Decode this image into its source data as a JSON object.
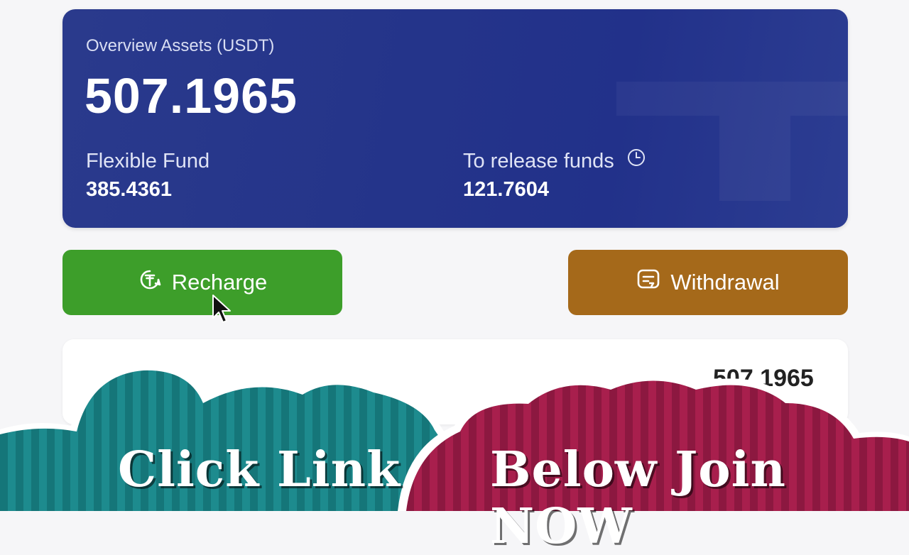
{
  "overview": {
    "title": "Overview Assets (USDT)",
    "total": "507.1965",
    "flexible_label": "Flexible Fund",
    "flexible_value": "385.4361",
    "release_label": "To release funds",
    "release_value": "121.7604"
  },
  "actions": {
    "recharge_label": "Recharge",
    "withdrawal_label": "Withdrawal"
  },
  "list": {
    "partial_value": "507.1965"
  },
  "banner": {
    "left_text": "Click Link",
    "right_text": "Below Join NOW"
  },
  "colors": {
    "card": "#24348a",
    "recharge": "#3d9e2a",
    "withdrawal": "#a5691a",
    "banner_left": "#1e8a8c",
    "banner_right": "#a01e4a"
  },
  "icons": {
    "clock": "clock-icon",
    "recharge": "usdt-recharge-icon",
    "withdrawal": "withdrawal-icon",
    "cursor": "mouse-pointer"
  }
}
